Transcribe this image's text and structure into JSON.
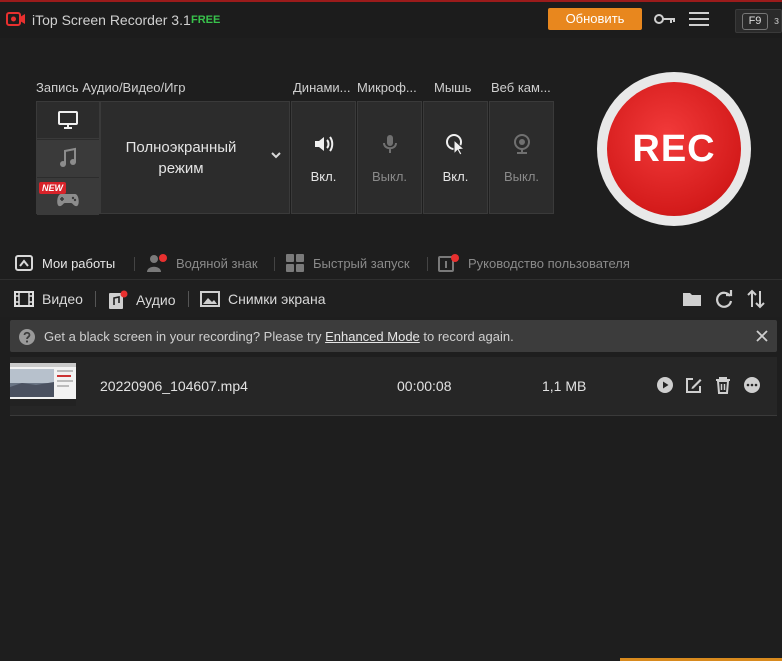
{
  "window": {
    "title": "iTop Screen Recorder 3.1",
    "edition_badge": "FREE",
    "upgrade_label": "Обновить",
    "hotkey_key": "F9",
    "hotkey_more": "з"
  },
  "capture": {
    "source_label": "Запись Аудио/Видео/Игр",
    "sources": [
      {
        "name": "monitor-icon",
        "active": true
      },
      {
        "name": "music-note-icon",
        "active": false
      },
      {
        "name": "gamepad-icon",
        "active": false,
        "badge": "NEW"
      }
    ],
    "mode_line1": "Полноэкранный",
    "mode_line2": "режим",
    "toggles": [
      {
        "label": "Динами...",
        "state": "Вкл.",
        "icon": "speaker-icon",
        "on": true
      },
      {
        "label": "Микроф...",
        "state": "Выкл.",
        "icon": "microphone-icon",
        "on": false
      },
      {
        "label": "Мышь",
        "state": "Вкл.",
        "icon": "mouse-cursor-icon",
        "on": true
      },
      {
        "label": "Веб кам...",
        "state": "Выкл.",
        "icon": "webcam-icon",
        "on": false
      }
    ],
    "rec_label": "REC"
  },
  "quicklinks": [
    {
      "label": "Мои работы",
      "icon": "my-works-icon"
    },
    {
      "label": "Водяной знак",
      "icon": "watermark-icon"
    },
    {
      "label": "Быстрый запуск",
      "icon": "quick-launch-icon"
    },
    {
      "label": "Руководство пользователя",
      "icon": "user-guide-icon"
    }
  ],
  "tabs": [
    {
      "label": "Видео",
      "icon": "film-icon"
    },
    {
      "label": "Аудио",
      "icon": "audio-file-icon"
    },
    {
      "label": "Снимки экрана",
      "icon": "image-icon"
    }
  ],
  "notice": {
    "text_before": "Get a black screen in your recording? Please try ",
    "link": "Enhanced Mode",
    "text_after": " to record again."
  },
  "files": [
    {
      "name": "20220906_104607.mp4",
      "duration": "00:00:08",
      "size": "1,1 MB"
    }
  ],
  "colors": {
    "accent": "#e8871e",
    "rec": "#d41b1b",
    "free": "#38c24b",
    "background": "#1e1e1e"
  }
}
